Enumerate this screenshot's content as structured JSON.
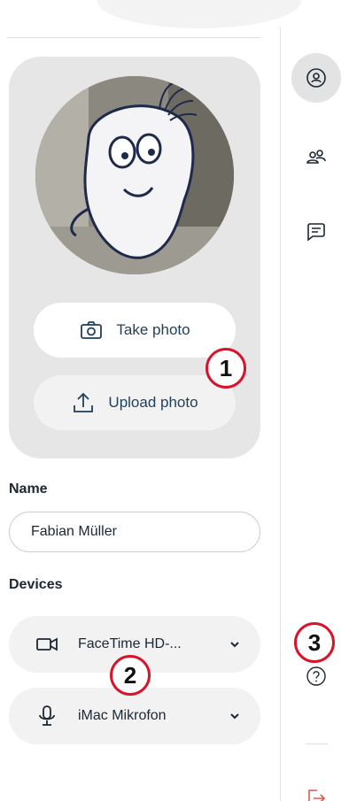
{
  "photo": {
    "take_label": "Take photo",
    "upload_label": "Upload photo"
  },
  "profile": {
    "name_label": "Name",
    "name_value": "Fabian Müller",
    "devices_label": "Devices"
  },
  "devices": {
    "camera_label": "FaceTime HD-...",
    "mic_label": "iMac Mikrofon"
  },
  "markers": [
    "1",
    "2",
    "3"
  ],
  "icons": {
    "camera": "camera-icon",
    "upload": "upload-icon",
    "video": "video-camera-icon",
    "mic": "microphone-icon",
    "chevron": "chevron-down-icon",
    "profile": "user-circle-icon",
    "people": "users-icon",
    "chat": "chat-icon",
    "help": "help-icon",
    "exit": "exit-icon"
  },
  "colors": {
    "accent_text": "#1f3f5a",
    "exit_icon": "#e4564b",
    "marker": "#d8132a",
    "card_bg": "#e6e6e6"
  }
}
